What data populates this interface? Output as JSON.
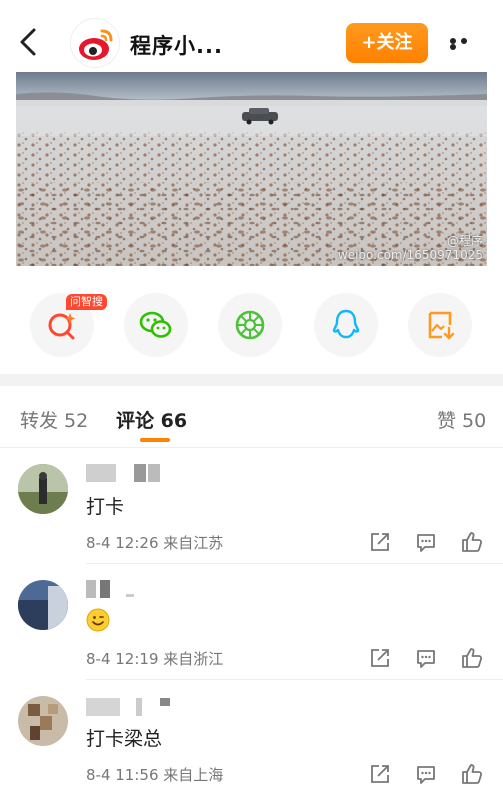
{
  "header": {
    "title": "程序小...",
    "follow_label": "+关注"
  },
  "photo": {
    "watermark_line1": "@程序",
    "watermark_line2": "weibo.com/1650971025"
  },
  "share": {
    "badge": "问智搜",
    "buttons": [
      "smart-search-icon",
      "wechat-icon",
      "moments-icon",
      "qq-icon",
      "save-image-icon"
    ]
  },
  "tabs": {
    "repost": "转发 52",
    "comments": "评论 66",
    "likes": "赞 50"
  },
  "comments": [
    {
      "text": "打卡",
      "meta": "8-4 12:26 来自江苏"
    },
    {
      "text": "",
      "emoji": "smiley-emoji",
      "meta": "8-4 12:19 来自浙江"
    },
    {
      "text": "打卡梁总",
      "meta": "8-4 11:56 来自上海"
    }
  ],
  "colors": {
    "accent": "#ff8200",
    "badge": "#ff4830"
  }
}
